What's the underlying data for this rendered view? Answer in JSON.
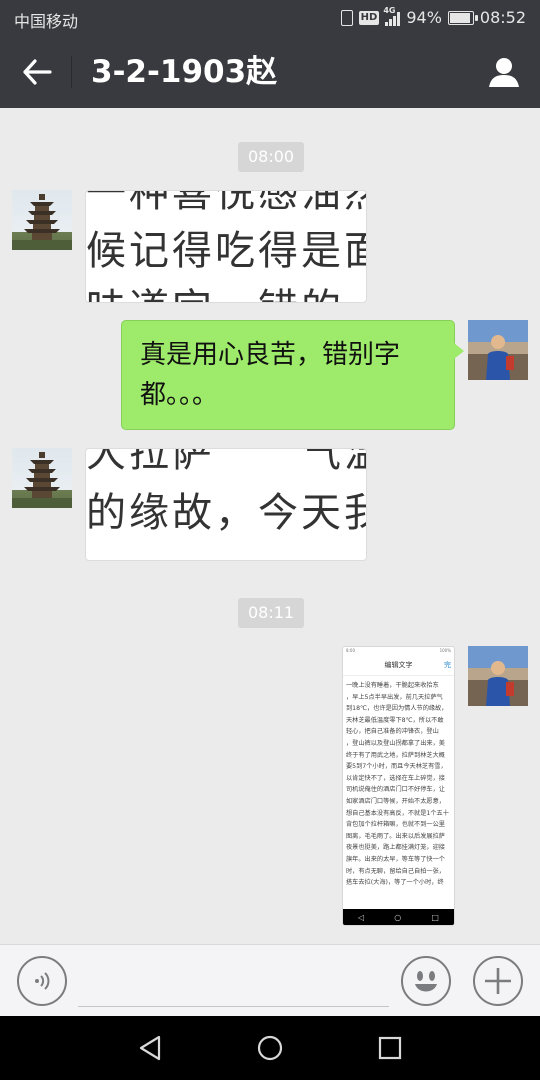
{
  "status_bar": {
    "carrier": "中国移动",
    "network": "4G",
    "hd_label": "HD",
    "battery": "94%",
    "time": "08:52"
  },
  "header": {
    "title": "3-2-1903赵",
    "back_icon": "arrow-left-icon",
    "profile_icon": "person-icon"
  },
  "messages": [
    {
      "type": "timestamp",
      "text": "08:00"
    },
    {
      "type": "image",
      "side": "left",
      "text_lines": [
        "一种喜悦感油然",
        "候记得吃得是面",
        "味道完一错的"
      ]
    },
    {
      "type": "text",
      "side": "right",
      "text": "真是用心良苦，错别字都。。。"
    },
    {
      "type": "image",
      "side": "left",
      "text_lines": [
        "大拉萨　　气温能",
        "的缘故，今天我"
      ]
    },
    {
      "type": "timestamp",
      "text": "08:11"
    },
    {
      "type": "screenshot",
      "side": "right",
      "status": "8:00",
      "battery": "100%",
      "header_title": "编辑文字",
      "header_action": "完",
      "lines": [
        "一晚上没有睡着，干脆起来收拾东",
        "，早上5点半早出发，前几天拉萨气",
        "到18℃，也许是因为情人节的缘故，",
        "天林芝最低温度零下8℃，所以不敢",
        "轻心，把自己准备的冲锋衣，登山",
        "，登山裤以及登山拐都拿了出来，美",
        "终于有了用武之地，拉萨到林芝大概",
        "要5到7个小时，而且今天林芝有雪，",
        "以肯定快不了，选择在车上碎觉，接",
        "司机说俺住的酒店门口不好停车，让",
        "如家酒店门口等候，开始不太愿意，",
        "想自己基本没有高反，不就是1个五十",
        "背包加个拉杆箱嘛，也就不到一公里",
        "图离，毛毛雨了。出来以后发展拉萨",
        "夜景也挺美，路上都挂满灯笼，迎接",
        "旗年。出来的太早，等车等了快一个",
        "时，有点无聊，留给自己自拍一张，",
        "搭车去拉(大海)，等了一个小时，终"
      ]
    }
  ],
  "input_bar": {
    "voice_icon": "voice-icon",
    "text_value": "",
    "emoji_icon": "emoji-icon",
    "plus_icon": "plus-icon"
  },
  "nav_bar": {
    "back_icon": "triangle-back-icon",
    "home_icon": "circle-home-icon",
    "recents_icon": "square-recents-icon"
  },
  "colors": {
    "title_bar": "#393a3f",
    "chat_background": "#ebebeb",
    "sent_bubble": "#9eea6a",
    "timestamp_bg": "#d6d6d6"
  }
}
